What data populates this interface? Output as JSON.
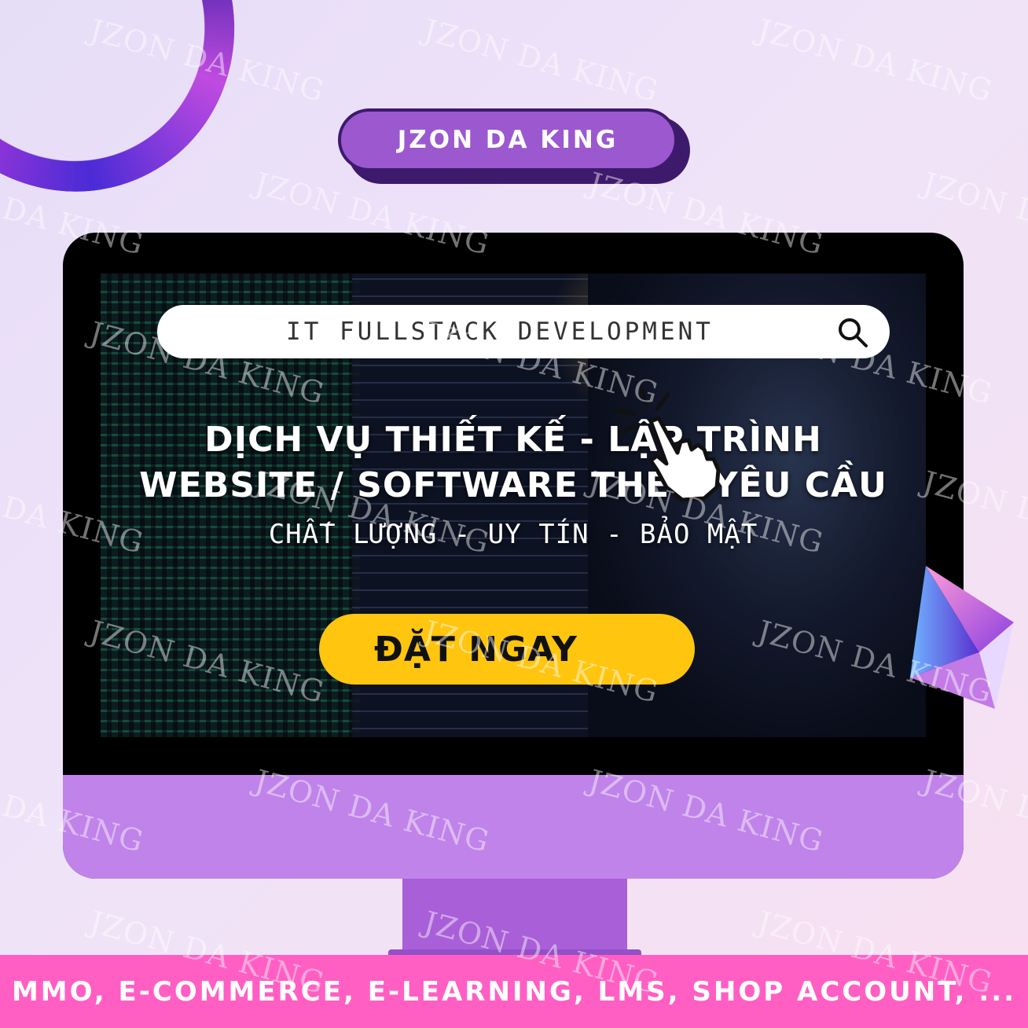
{
  "brand": {
    "label": "JZON DA KING"
  },
  "watermark": {
    "text": "JZON DA KING"
  },
  "search": {
    "text": "IT FULLSTACK DEVELOPMENT"
  },
  "headline": {
    "line1": "DỊCH VỤ THIẾT KẾ - LẬP TRÌNH",
    "line2": "WEBSITE / SOFTWARE THEO YÊU CẦU"
  },
  "tagline": "CHẤT LƯỢNG - UY TÍN - BẢO MẬT",
  "cta": {
    "label": "ĐẶT NGAY"
  },
  "footer": {
    "text": "MMO, E-COMMERCE, E-LEARNING, LMS, SHOP ACCOUNT, ..."
  },
  "colors": {
    "brand_pill": "#9b58cf",
    "cta": "#ffc50f",
    "footer": "#ff5fc3",
    "monitor_chin": "#c083ea"
  },
  "icons": [
    "search-icon",
    "pointer-hand-icon",
    "ring-decoration",
    "gem-decoration"
  ]
}
